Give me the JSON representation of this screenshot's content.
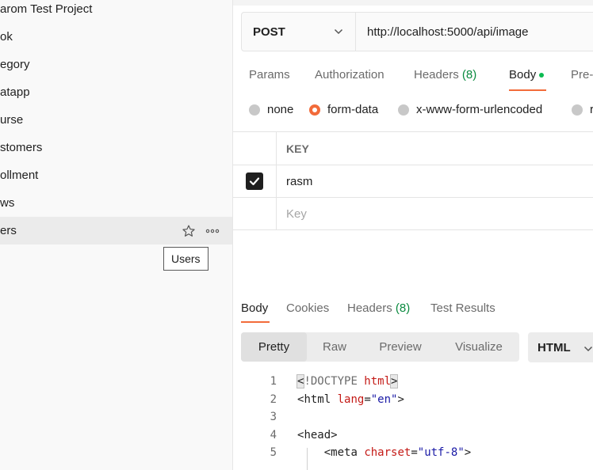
{
  "sidebar": {
    "items": [
      {
        "label": "arom Test Project"
      },
      {
        "label": "ok"
      },
      {
        "label": "egory"
      },
      {
        "label": "atapp"
      },
      {
        "label": "urse"
      },
      {
        "label": "stomers"
      },
      {
        "label": "ollment"
      },
      {
        "label": "ws"
      },
      {
        "label": "ers"
      }
    ],
    "active_icons": [
      "star-icon",
      "more-options-icon"
    ],
    "tooltip": "Users"
  },
  "request": {
    "method": "POST",
    "url": "http://localhost:5000/api/image",
    "tabs": [
      {
        "label": "Params"
      },
      {
        "label": "Authorization"
      },
      {
        "label": "Headers",
        "count": "(8)"
      },
      {
        "label": "Body",
        "active": true
      },
      {
        "label": "Pre-"
      }
    ],
    "body_types": [
      {
        "label": "none"
      },
      {
        "label": "form-data",
        "selected": true
      },
      {
        "label": "x-www-form-urlencoded"
      },
      {
        "label": "r"
      }
    ],
    "kv_header": "KEY",
    "kv_rows": [
      {
        "key": "rasm",
        "checked": true
      }
    ],
    "kv_placeholder": "Key"
  },
  "response": {
    "tabs": [
      {
        "label": "Body",
        "active": true
      },
      {
        "label": "Cookies"
      },
      {
        "label": "Headers",
        "count": "(8)"
      },
      {
        "label": "Test Results"
      }
    ],
    "views": [
      "Pretty",
      "Raw",
      "Preview",
      "Visualize"
    ],
    "active_view": "Pretty",
    "format": "HTML",
    "line_numbers": [
      "1",
      "2",
      "3",
      "4",
      "5"
    ],
    "code": {
      "l1_doctype": "!DOCTYPE ",
      "l1_kw": "html",
      "l2_tag": "html",
      "l2_attr": "lang",
      "l2_val": "\"en\"",
      "l4_tag": "head",
      "l5_tag": "meta",
      "l5_attr": "charset",
      "l5_val": "\"utf-8\""
    }
  },
  "colors": {
    "accent": "#f26b3a",
    "count_green": "#0a8a3f",
    "dot_green": "#0cbb52"
  }
}
